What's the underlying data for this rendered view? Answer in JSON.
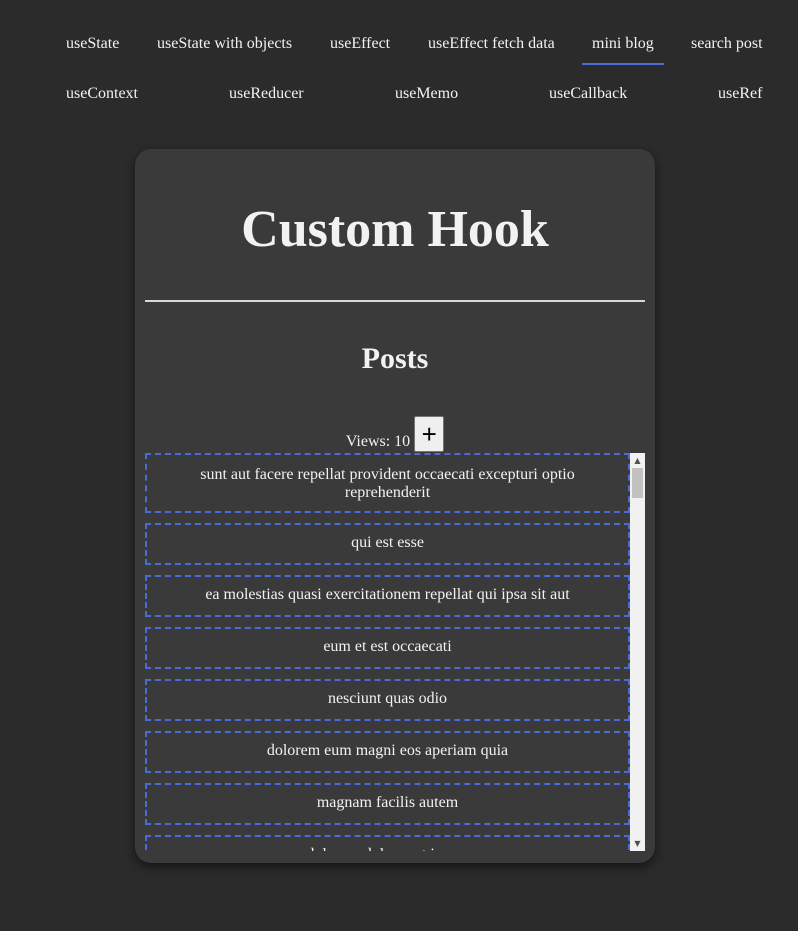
{
  "nav": {
    "row1": [
      "useState",
      "useState with objects",
      "useEffect",
      "useEffect fetch data",
      "mini blog",
      "search post"
    ],
    "row2": [
      "useContext",
      "useReducer",
      "useMemo",
      "useCallback",
      "useRef"
    ],
    "active": "mini blog"
  },
  "card": {
    "title": "Custom Hook",
    "section_heading": "Posts",
    "views_label": "Views: 10",
    "plus_label": "+"
  },
  "posts": [
    "sunt aut facere repellat provident occaecati excepturi optio reprehenderit",
    "qui est esse",
    "ea molestias quasi exercitationem repellat qui ipsa sit aut",
    "eum et est occaecati",
    "nesciunt quas odio",
    "dolorem eum magni eos aperiam quia",
    "magnam facilis autem",
    "dolorem dolore est ipsam"
  ],
  "scrollbar": {
    "up_icon": "triangle-up",
    "down_icon": "triangle-down"
  },
  "colors": {
    "page_bg": "#2b2b2b",
    "card_bg": "#3a3a3a",
    "accent": "#4a6bd8"
  }
}
